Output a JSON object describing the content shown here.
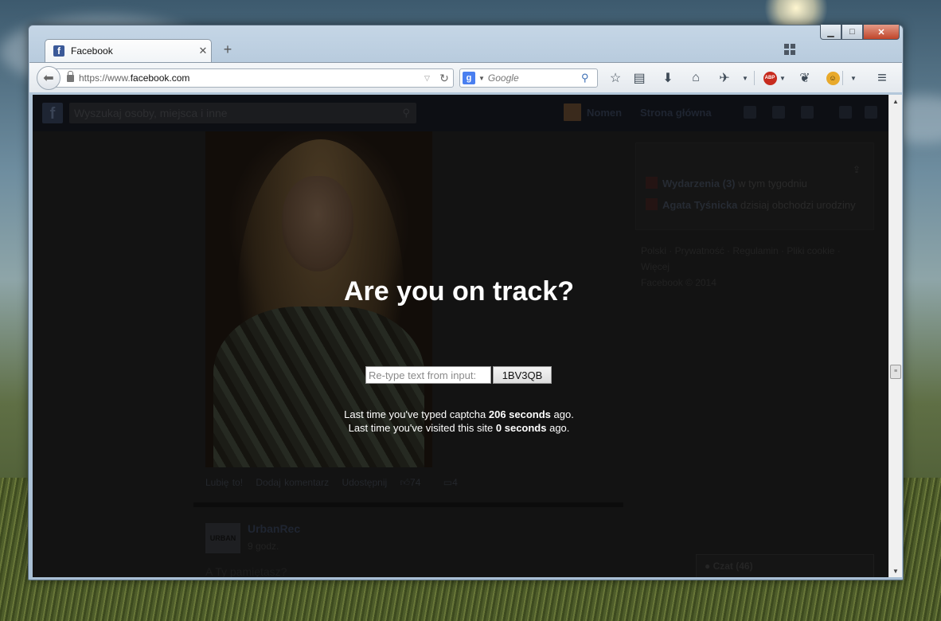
{
  "browser": {
    "tab": {
      "title": "Facebook",
      "favicon": "f"
    },
    "url_prefix": "https://www.",
    "url_domain": "facebook.com",
    "search_placeholder": "Google",
    "window_controls": {
      "minimize": "▁",
      "maximize": "□",
      "close": "✕"
    },
    "abp_label": "ABP"
  },
  "facebook": {
    "search_placeholder": "Wyszukaj osoby, miejsca i inne",
    "user_name": "Nomen",
    "home_link": "Strona główna",
    "post_actions": {
      "like": "Lubię to!",
      "comment": "Dodaj komentarz",
      "share": "Udostępnij",
      "likes_count": "74",
      "comments_count": "4"
    },
    "second_post": {
      "author": "UrbanRec",
      "time": "9 godz.",
      "text": "A Ty pamiętasz?",
      "avatar_text": "URBAN"
    },
    "right_column": {
      "events_label": "Wydarzenia (3)",
      "events_suffix": "w tym tygodniu",
      "birthday_name": "Agata Tyśnicka",
      "birthday_suffix": "dzisiaj obchodzi urodziny",
      "footer_links": "Polski · Prywatność · Regulamin · Pliki cookie · Więcej",
      "copyright": "Facebook © 2014"
    },
    "chat_label": "Czat (46)"
  },
  "captcha": {
    "title": "Are you on track?",
    "input_placeholder": "Re-type text from input:",
    "code_button": "1BV3QB",
    "line1_prefix": "Last time you've typed captcha ",
    "line1_bold": "206 seconds",
    "line1_suffix": " ago.",
    "line2_prefix": "Last time you've visited this site ",
    "line2_bold": "0 seconds",
    "line2_suffix": " ago."
  }
}
